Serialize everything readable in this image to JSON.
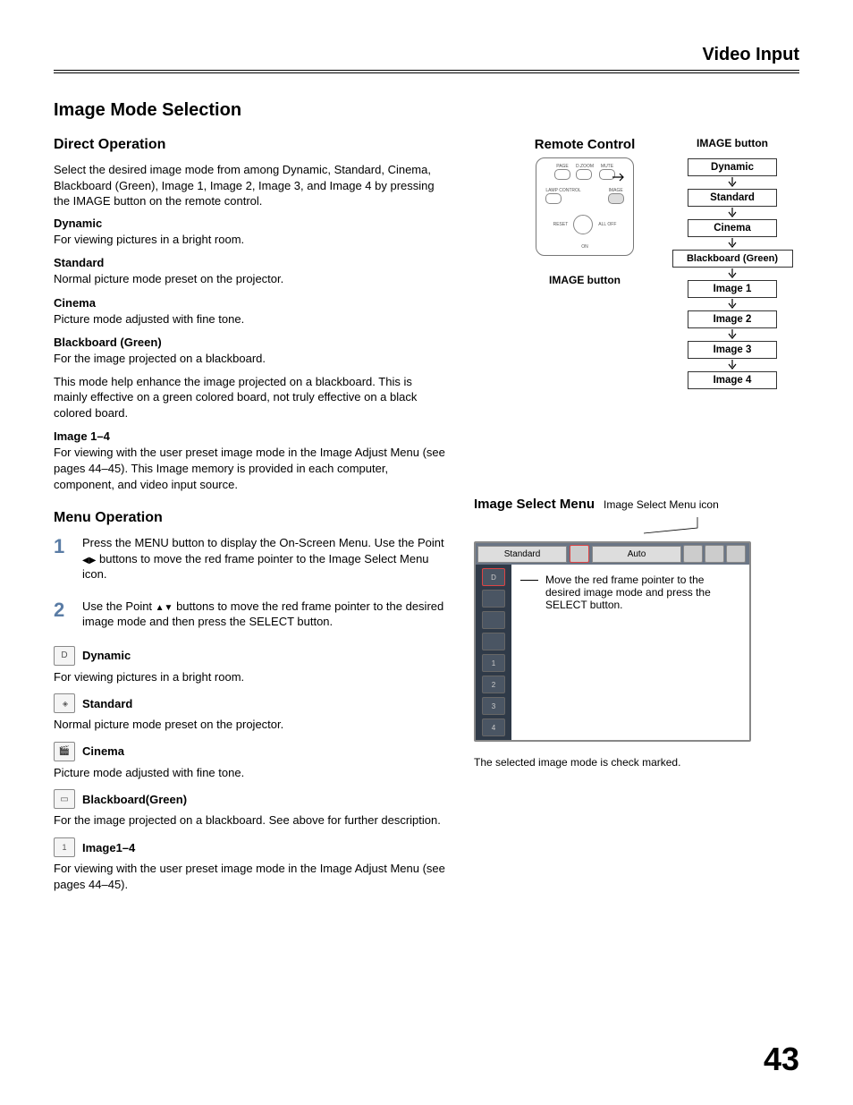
{
  "header": {
    "section": "Video Input"
  },
  "page_number": "43",
  "main_heading": "Image Mode Selection",
  "direct_op": {
    "heading": "Direct Operation",
    "intro": "Select the desired image mode from among Dynamic, Standard, Cinema, Blackboard (Green), Image 1, Image 2, Image 3, and Image 4 by pressing the IMAGE button on the remote control.",
    "modes": {
      "dynamic": {
        "title": "Dynamic",
        "desc": "For viewing pictures in a bright room."
      },
      "standard": {
        "title": "Standard",
        "desc": "Normal picture mode preset on the projector."
      },
      "cinema": {
        "title": "Cinema",
        "desc": "Picture mode adjusted with fine tone."
      },
      "blackboard": {
        "title": "Blackboard (Green)",
        "desc1": "For the image projected on a blackboard.",
        "desc2": "This mode help enhance the image projected on a blackboard. This is mainly effective on a green colored board, not truly effective on a black colored board."
      },
      "image14": {
        "title": "Image 1–4",
        "desc": "For viewing with the user preset image mode in the Image Adjust Menu (see pages 44–45). This Image memory is provided in each computer, component, and video input source."
      }
    }
  },
  "menu_op": {
    "heading": "Menu Operation",
    "steps": {
      "s1": {
        "num": "1",
        "text_a": "Press the MENU button to display the On-Screen Menu. Use the Point ",
        "text_b": " buttons to move the red frame pointer to the Image Select Menu icon."
      },
      "s2": {
        "num": "2",
        "text_a": "Use the Point ",
        "text_b": " buttons to move the red frame pointer to the desired image mode and then press the SELECT button."
      }
    },
    "modes": {
      "dynamic": {
        "title": "Dynamic",
        "desc": "For viewing pictures in a bright room."
      },
      "standard": {
        "title": "Standard",
        "desc": "Normal picture mode preset on the projector."
      },
      "cinema": {
        "title": "Cinema",
        "desc": "Picture mode adjusted with fine tone."
      },
      "blackboard": {
        "title": "Blackboard(Green)",
        "desc": "For the image projected on a blackboard. See above for further description."
      },
      "image14": {
        "title": "Image1–4",
        "desc": "For viewing with the user preset image mode in the Image Adjust Menu (see pages 44–45)."
      }
    }
  },
  "remote": {
    "heading": "Remote Control",
    "buttons": {
      "page": "PAGE",
      "dzoom": "D.ZOOM",
      "mute": "MUTE",
      "lamp": "LAMP CONTROL",
      "image": "IMAGE",
      "reset": "RESET",
      "alloff": "ALL OFF",
      "on": "ON"
    },
    "caption": "IMAGE button"
  },
  "flowchart": {
    "heading": "IMAGE button",
    "items": [
      "Dynamic",
      "Standard",
      "Cinema",
      "Blackboard (Green)",
      "Image 1",
      "Image 2",
      "Image 3",
      "Image 4"
    ]
  },
  "image_select_menu": {
    "heading": "Image Select Menu",
    "icon_caption": "Image Select Menu icon",
    "top_left": "Standard",
    "top_right": "Auto",
    "note": "Move the red frame pointer to the desired image mode and press the SELECT button.",
    "check_note": "The selected image mode is check marked.",
    "side_labels": [
      "D",
      "",
      "",
      "",
      "1",
      "2",
      "3",
      "4"
    ]
  }
}
